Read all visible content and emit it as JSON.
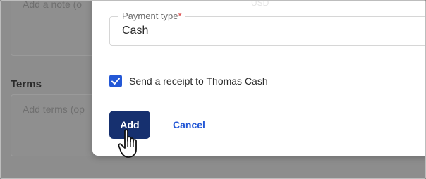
{
  "background": {
    "note_placeholder": "Add a note (o",
    "terms_label": "Terms",
    "terms_placeholder": "Add terms (op"
  },
  "modal": {
    "currency_hint": "USD",
    "payment_type": {
      "label": "Payment type",
      "required_mark": "*",
      "value": "Cash"
    },
    "receipt_checkbox": {
      "checked": true,
      "label": "Send a receipt to Thomas Cash"
    },
    "actions": {
      "add_label": "Add",
      "cancel_label": "Cancel"
    }
  },
  "colors": {
    "primary": "#16306f",
    "accent": "#2458d6",
    "required": "#d93a3a",
    "overlay": "#8d8d8d"
  },
  "icons": {
    "checkbox": "checkmark-icon",
    "cursor": "hand-pointer-cursor-icon"
  }
}
